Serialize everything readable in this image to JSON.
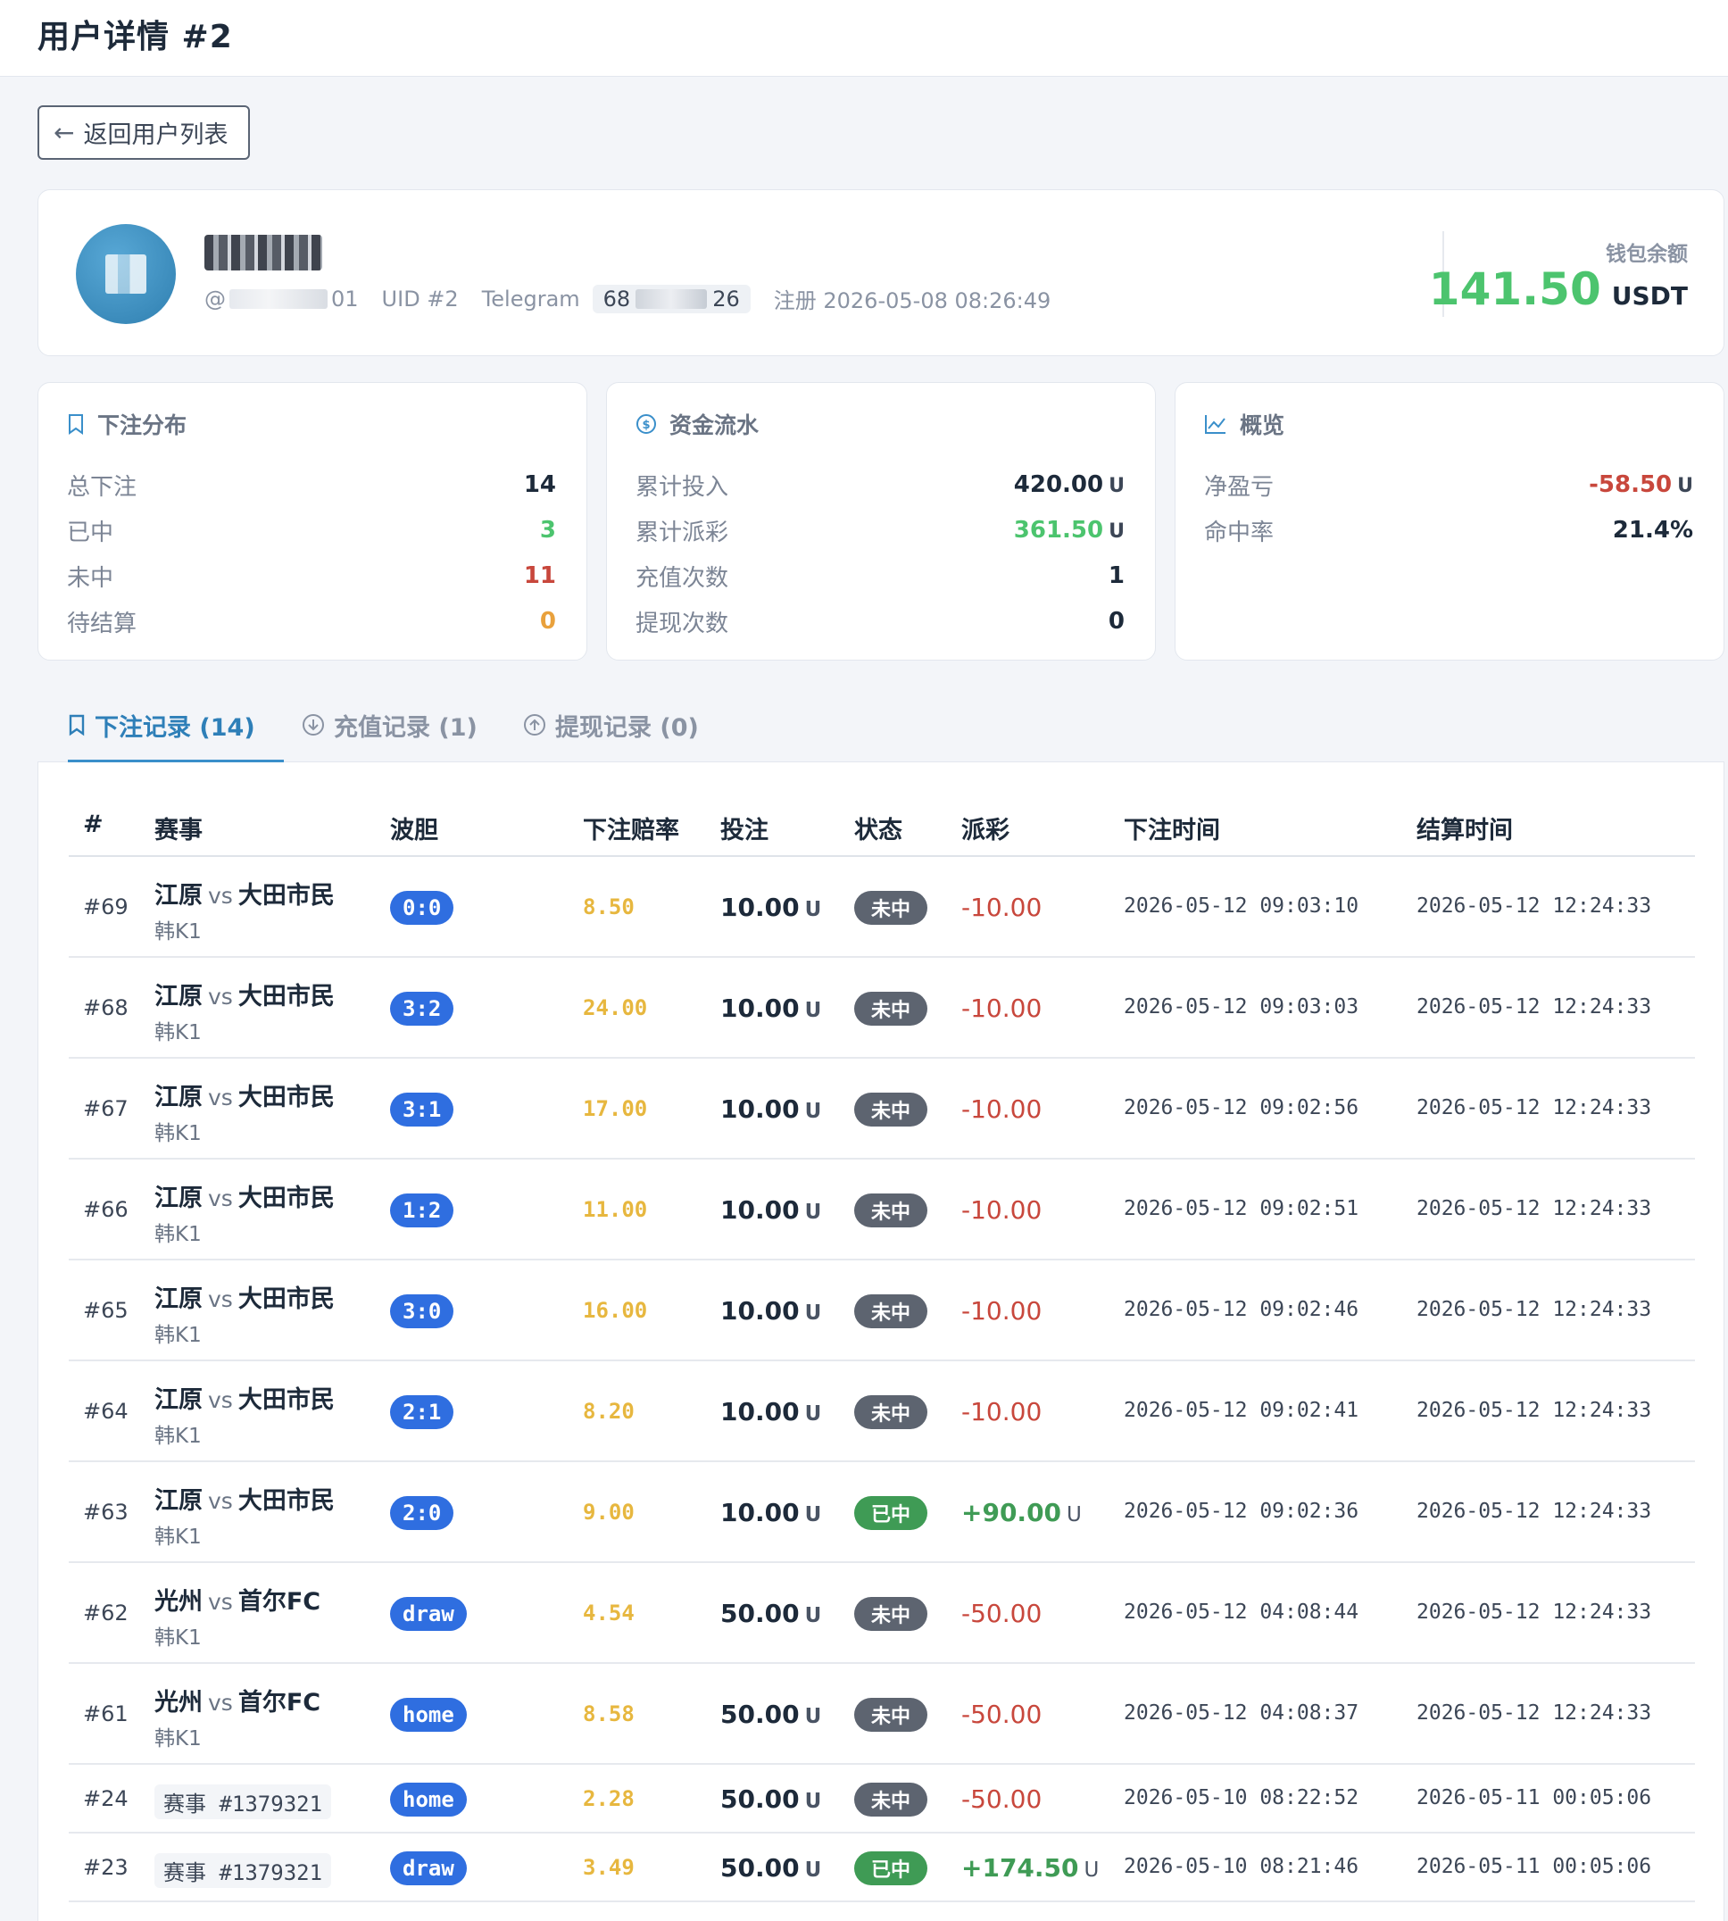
{
  "header": {
    "title": "用户详情 #2"
  },
  "back_button": {
    "label": "返回用户列表"
  },
  "profile": {
    "handle_prefix": "@",
    "handle_suffix": "01",
    "uid": "UID #2",
    "telegram_label": "Telegram",
    "telegram_prefix": "68",
    "telegram_suffix": "26",
    "registered": "注册 2026-05-08 08:26:49",
    "wallet_label": "钱包余额",
    "wallet_value": "141.50",
    "wallet_unit": "USDT"
  },
  "bet_stats": {
    "title": "下注分布",
    "rows": [
      {
        "label": "总下注",
        "value": "14"
      },
      {
        "label": "已中",
        "value": "3"
      },
      {
        "label": "未中",
        "value": "11"
      },
      {
        "label": "待结算",
        "value": "0"
      }
    ]
  },
  "fund_stats": {
    "title": "资金流水",
    "rows": [
      {
        "label": "累计投入",
        "value": "420.00",
        "unit": "U"
      },
      {
        "label": "累计派彩",
        "value": "361.50",
        "unit": "U"
      },
      {
        "label": "充值次数",
        "value": "1"
      },
      {
        "label": "提现次数",
        "value": "0"
      }
    ]
  },
  "overview": {
    "title": "概览",
    "rows": [
      {
        "label": "净盈亏",
        "value": "-58.50",
        "unit": "U"
      },
      {
        "label": "命中率",
        "value": "21.4%"
      }
    ]
  },
  "tabs": [
    {
      "label": "下注记录 (14)",
      "active": true,
      "icon": "bookmark-icon"
    },
    {
      "label": "充值记录 (1)",
      "active": false,
      "icon": "download-circle-icon"
    },
    {
      "label": "提现记录 (0)",
      "active": false,
      "icon": "upload-circle-icon"
    }
  ],
  "table": {
    "headers": [
      "#",
      "赛事",
      "波胆",
      "下注赔率",
      "投注",
      "状态",
      "派彩",
      "下注时间",
      "结算时间"
    ],
    "unit": "U",
    "vs": "vs",
    "rows": [
      {
        "id": "#69",
        "home": "江原",
        "away": "大田市民",
        "league": "韩K1",
        "pick": "0:0",
        "odds": "8.50",
        "stake": "10.00",
        "status": "未中",
        "payout": "-10.00",
        "bet_time": "2026-05-12 09:03:10",
        "settle_time": "2026-05-12 12:24:33"
      },
      {
        "id": "#68",
        "home": "江原",
        "away": "大田市民",
        "league": "韩K1",
        "pick": "3:2",
        "odds": "24.00",
        "stake": "10.00",
        "status": "未中",
        "payout": "-10.00",
        "bet_time": "2026-05-12 09:03:03",
        "settle_time": "2026-05-12 12:24:33"
      },
      {
        "id": "#67",
        "home": "江原",
        "away": "大田市民",
        "league": "韩K1",
        "pick": "3:1",
        "odds": "17.00",
        "stake": "10.00",
        "status": "未中",
        "payout": "-10.00",
        "bet_time": "2026-05-12 09:02:56",
        "settle_time": "2026-05-12 12:24:33"
      },
      {
        "id": "#66",
        "home": "江原",
        "away": "大田市民",
        "league": "韩K1",
        "pick": "1:2",
        "odds": "11.00",
        "stake": "10.00",
        "status": "未中",
        "payout": "-10.00",
        "bet_time": "2026-05-12 09:02:51",
        "settle_time": "2026-05-12 12:24:33"
      },
      {
        "id": "#65",
        "home": "江原",
        "away": "大田市民",
        "league": "韩K1",
        "pick": "3:0",
        "odds": "16.00",
        "stake": "10.00",
        "status": "未中",
        "payout": "-10.00",
        "bet_time": "2026-05-12 09:02:46",
        "settle_time": "2026-05-12 12:24:33"
      },
      {
        "id": "#64",
        "home": "江原",
        "away": "大田市民",
        "league": "韩K1",
        "pick": "2:1",
        "odds": "8.20",
        "stake": "10.00",
        "status": "未中",
        "payout": "-10.00",
        "bet_time": "2026-05-12 09:02:41",
        "settle_time": "2026-05-12 12:24:33"
      },
      {
        "id": "#63",
        "home": "江原",
        "away": "大田市民",
        "league": "韩K1",
        "pick": "2:0",
        "odds": "9.00",
        "stake": "10.00",
        "status": "已中",
        "payout": "+90.00",
        "bet_time": "2026-05-12 09:02:36",
        "settle_time": "2026-05-12 12:24:33"
      },
      {
        "id": "#62",
        "home": "光州",
        "away": "首尔FC",
        "league": "韩K1",
        "pick": "draw",
        "odds": "4.54",
        "stake": "50.00",
        "status": "未中",
        "payout": "-50.00",
        "bet_time": "2026-05-12 04:08:44",
        "settle_time": "2026-05-12 12:24:33"
      },
      {
        "id": "#61",
        "home": "光州",
        "away": "首尔FC",
        "league": "韩K1",
        "pick": "home",
        "odds": "8.58",
        "stake": "50.00",
        "status": "未中",
        "payout": "-50.00",
        "bet_time": "2026-05-12 04:08:37",
        "settle_time": "2026-05-12 12:24:33"
      },
      {
        "id": "#24",
        "ref": "赛事 #1379321",
        "pick": "home",
        "odds": "2.28",
        "stake": "50.00",
        "status": "未中",
        "payout": "-50.00",
        "bet_time": "2026-05-10 08:22:52",
        "settle_time": "2026-05-11 00:05:06"
      },
      {
        "id": "#23",
        "ref": "赛事 #1379321",
        "pick": "draw",
        "odds": "3.49",
        "stake": "50.00",
        "status": "已中",
        "payout": "+174.50",
        "bet_time": "2026-05-10 08:21:46",
        "settle_time": "2026-05-11 00:05:06"
      }
    ]
  },
  "colors": {
    "accent": "#2e7fb8",
    "win": "#4cc46e",
    "loss": "#c8473c",
    "pending": "#e9a13c",
    "pick_badge": "#2f6ee0"
  }
}
